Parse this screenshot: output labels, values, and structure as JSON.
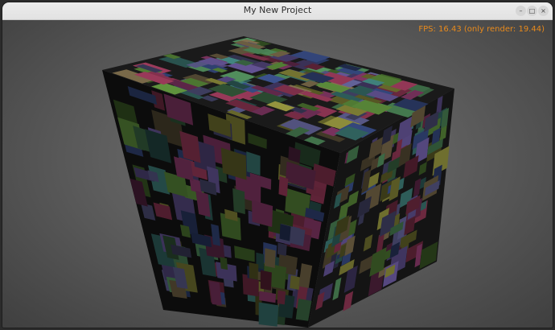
{
  "window": {
    "title": "My New Project",
    "minimize_icon": "minimize-icon",
    "maximize_icon": "maximize-icon",
    "close_icon": "close-icon"
  },
  "overlay": {
    "fps_text": "FPS: 16.43 (only render: 19.44)",
    "fps_color": "#e88a1c"
  },
  "scene": {
    "description_color_palette": [
      "#5a8a3a",
      "#3f7f7a",
      "#8b3a6b",
      "#6b5aa0",
      "#8a8a3a",
      "#3a4f8a",
      "#9a3a5a",
      "#4f8a5a",
      "#7a6a4a",
      "#5a5a8a"
    ]
  }
}
